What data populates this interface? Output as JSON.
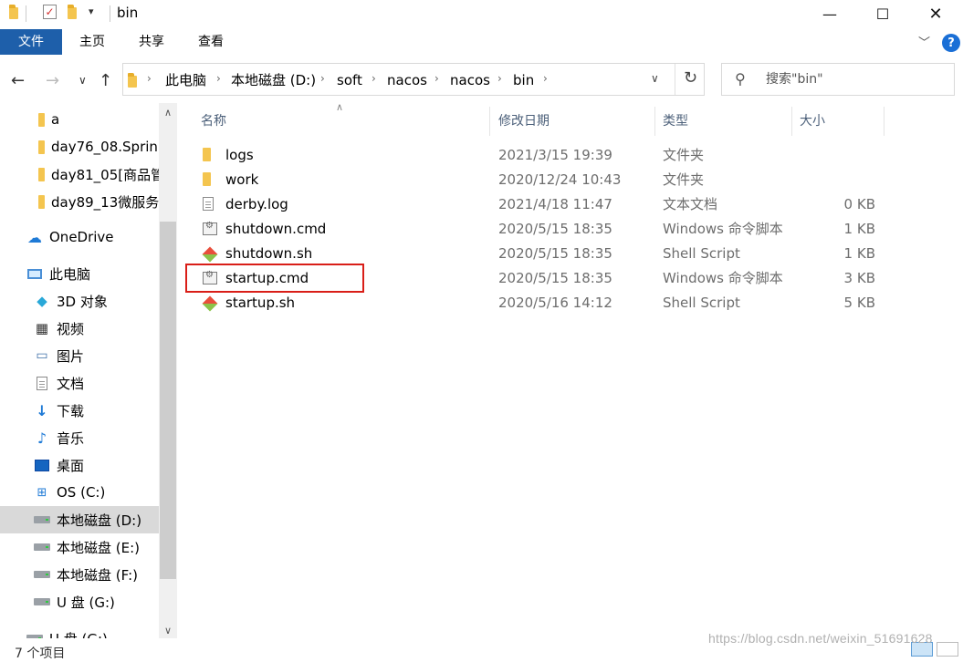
{
  "window": {
    "title": "bin"
  },
  "ribbon": {
    "tabs": [
      "文件",
      "主页",
      "共享",
      "查看"
    ]
  },
  "address": {
    "crumbs": [
      "此电脑",
      "本地磁盘 (D:)",
      "soft",
      "nacos",
      "nacos",
      "bin"
    ]
  },
  "search": {
    "placeholder": "搜索\"bin\""
  },
  "sidebar": {
    "items": [
      {
        "label": "a",
        "icon": "folder-icon"
      },
      {
        "label": "day76_08.Sprin",
        "icon": "folder-icon"
      },
      {
        "label": "day81_05[商品管",
        "icon": "folder-icon"
      },
      {
        "label": "day89_13微服务",
        "icon": "folder-icon"
      },
      {
        "label": "OneDrive",
        "icon": "cloud-icon"
      },
      {
        "label": "此电脑",
        "icon": "computer-icon"
      },
      {
        "label": "3D 对象",
        "icon": "cube-icon"
      },
      {
        "label": "视频",
        "icon": "video-icon"
      },
      {
        "label": "图片",
        "icon": "picture-icon"
      },
      {
        "label": "文档",
        "icon": "document-icon"
      },
      {
        "label": "下载",
        "icon": "download-icon"
      },
      {
        "label": "音乐",
        "icon": "music-icon"
      },
      {
        "label": "桌面",
        "icon": "desktop-icon"
      },
      {
        "label": "OS (C:)",
        "icon": "windows-drive-icon"
      },
      {
        "label": "本地磁盘 (D:)",
        "icon": "drive-icon",
        "selected": true
      },
      {
        "label": "本地磁盘 (E:)",
        "icon": "drive-icon"
      },
      {
        "label": "本地磁盘 (F:)",
        "icon": "drive-icon"
      },
      {
        "label": "U 盘 (G:)",
        "icon": "usb-drive-icon"
      },
      {
        "label": "U 盘 (G:)",
        "icon": "usb-drive-icon"
      }
    ]
  },
  "columns": {
    "name": "名称",
    "date": "修改日期",
    "type": "类型",
    "size": "大小"
  },
  "files": [
    {
      "name": "logs",
      "date": "2021/3/15 19:39",
      "type": "文件夹",
      "size": "",
      "icon": "folder-icon"
    },
    {
      "name": "work",
      "date": "2020/12/24 10:43",
      "type": "文件夹",
      "size": "",
      "icon": "folder-icon"
    },
    {
      "name": "derby.log",
      "date": "2021/4/18 11:47",
      "type": "文本文档",
      "size": "0 KB",
      "icon": "text-file-icon"
    },
    {
      "name": "shutdown.cmd",
      "date": "2020/5/15 18:35",
      "type": "Windows 命令脚本",
      "size": "1 KB",
      "icon": "cmd-file-icon"
    },
    {
      "name": "shutdown.sh",
      "date": "2020/5/15 18:35",
      "type": "Shell Script",
      "size": "1 KB",
      "icon": "shell-script-icon"
    },
    {
      "name": "startup.cmd",
      "date": "2020/5/15 18:35",
      "type": "Windows 命令脚本",
      "size": "3 KB",
      "icon": "cmd-file-icon",
      "highlighted": true
    },
    {
      "name": "startup.sh",
      "date": "2020/5/16 14:12",
      "type": "Shell Script",
      "size": "5 KB",
      "icon": "shell-script-icon"
    }
  ],
  "status": {
    "count": "7 个项目"
  },
  "watermark": "https://blog.csdn.net/weixin_51691628",
  "colors": {
    "accent": "#1e5faa",
    "highlight": "#d91e18",
    "selected": "#d9d9d9"
  }
}
